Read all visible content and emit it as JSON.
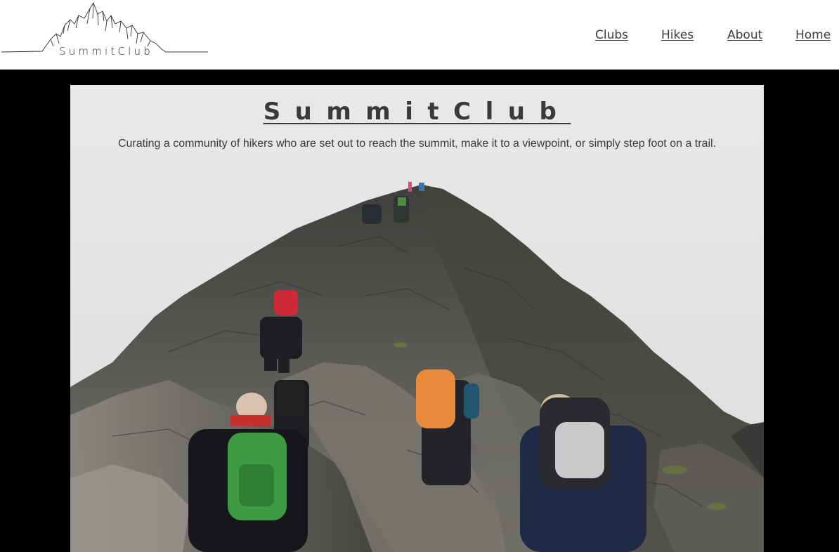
{
  "header": {
    "logo": {
      "text": "SummitClub",
      "icon": "mountain-range-icon"
    },
    "nav": [
      {
        "label": "Clubs"
      },
      {
        "label": "Hikes"
      },
      {
        "label": "About"
      },
      {
        "label": "Home"
      }
    ]
  },
  "hero": {
    "title": "SummitClub",
    "tagline": "Curating a community of hikers who are set out to reach the summit, make it to a viewpoint, or simply step foot on a trail.",
    "image": "hikers-climbing-rocky-ridge"
  },
  "colors": {
    "header_bg": "#ffffff",
    "page_bg": "#000000",
    "hero_sky": "#e7e7e8",
    "text": "#3a3a3a"
  }
}
